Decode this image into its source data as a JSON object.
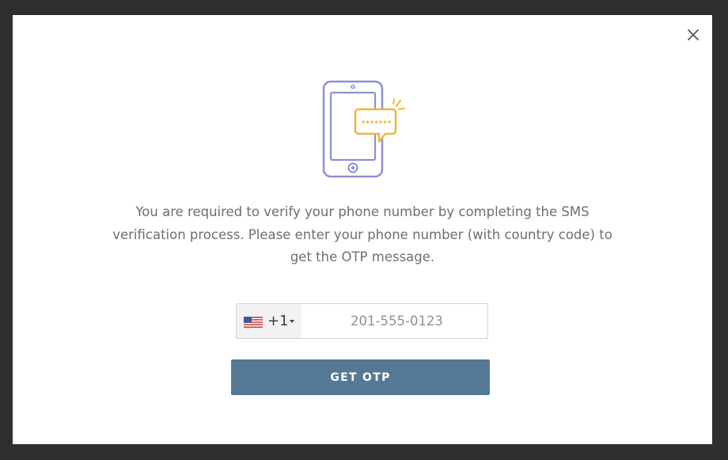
{
  "modal": {
    "close_icon": "close-icon",
    "illustration_icon": "phone-sms-icon",
    "message": "You are required to verify your phone number by completing the SMS verification process. Please enter your phone number (with country code) to get the OTP message.",
    "phone": {
      "country_flag_icon": "us-flag-icon",
      "dial_code": "+1",
      "placeholder": "201-555-0123",
      "value": ""
    },
    "submit_label": "GET OTP"
  },
  "colors": {
    "button": "#557895",
    "illustration_phone": "#8f8fd3",
    "illustration_bubble": "#f2b43c",
    "text": "#6a6f75",
    "backdrop": "#2f2f2f"
  }
}
